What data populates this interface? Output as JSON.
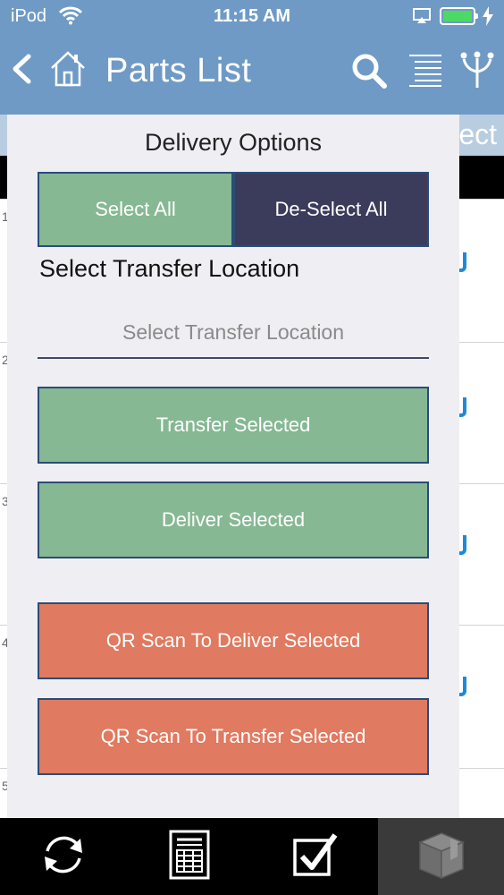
{
  "status_bar": {
    "carrier": "iPod",
    "time": "11:15 AM"
  },
  "nav": {
    "title": "Parts List"
  },
  "background": {
    "strip_text": "ect",
    "list_numbers": [
      "1",
      "2",
      "3",
      "4",
      "5"
    ]
  },
  "modal": {
    "title": "Delivery Options",
    "select_all_label": "Select All",
    "deselect_all_label": "De-Select All",
    "location_label": "Select Transfer Location",
    "location_placeholder": "Select Transfer Location",
    "transfer_selected_label": "Transfer Selected",
    "deliver_selected_label": "Deliver Selected",
    "qr_deliver_label": "QR Scan To Deliver Selected",
    "qr_transfer_label": "QR Scan To Transfer Selected"
  },
  "tab_bar": {
    "tabs": [
      {
        "icon": "refresh-icon"
      },
      {
        "icon": "form-icon"
      },
      {
        "icon": "checkbox-icon"
      },
      {
        "icon": "package-icon",
        "active": true
      }
    ]
  },
  "colors": {
    "header": "#6f9ac6",
    "green_button": "#86b893",
    "dark_button": "#3b3b5c",
    "orange_button": "#e07a60",
    "modal_bg": "#efeef3"
  }
}
